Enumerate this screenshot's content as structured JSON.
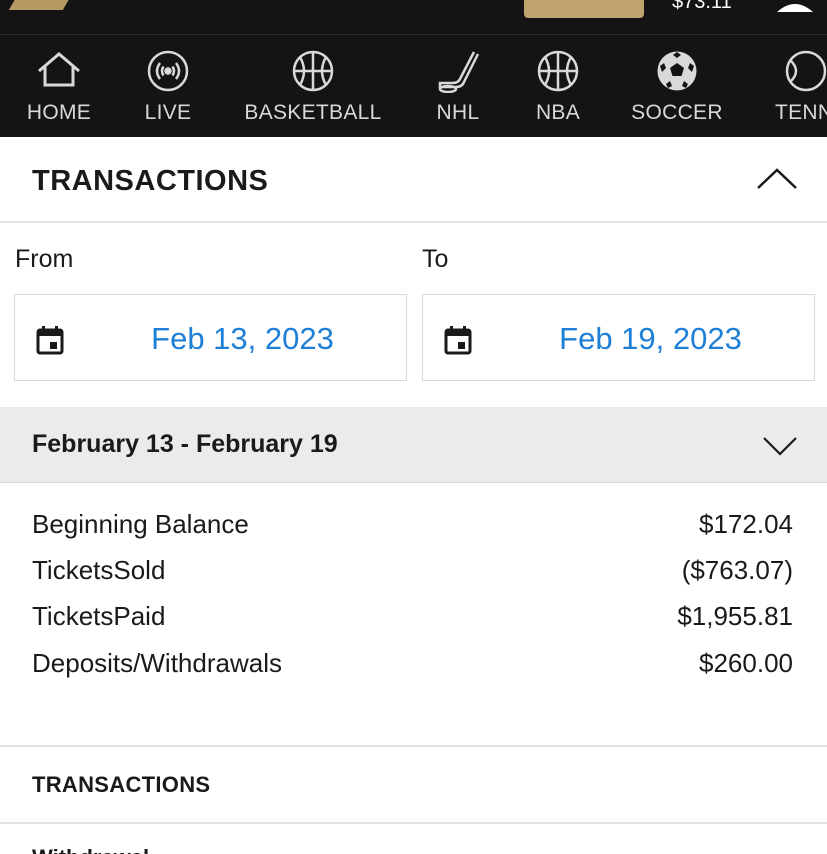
{
  "header": {
    "balance_label": "$73.11 ",
    "logo_icon": "brand-logo",
    "user_icon": "user-icon"
  },
  "sport_nav": {
    "items": [
      {
        "label": "HOME",
        "icon": "home-icon"
      },
      {
        "label": "LIVE",
        "icon": "live-broadcast-icon"
      },
      {
        "label": "BASKETBALL",
        "icon": "basketball-icon"
      },
      {
        "label": "NHL",
        "icon": "hockey-stick-icon"
      },
      {
        "label": "NBA",
        "icon": "basketball-icon"
      },
      {
        "label": "SOCCER",
        "icon": "soccer-ball-icon"
      },
      {
        "label": "TENN",
        "icon": "tennis-ball-icon"
      }
    ]
  },
  "transactions": {
    "title": "TRANSACTIONS",
    "from_label": "From",
    "to_label": "To",
    "from_date": "Feb 13, 2023",
    "to_date": "Feb 19, 2023",
    "period_title": "February 13 - February 19",
    "summary": [
      {
        "label": "Beginning Balance",
        "value": "$172.04"
      },
      {
        "label": "TicketsSold",
        "value": "($763.07)"
      },
      {
        "label": "TicketsPaid",
        "value": "$1,955.81"
      },
      {
        "label": "Deposits/Withdrawals",
        "value": "$260.00"
      }
    ],
    "list_title": "TRANSACTIONS",
    "first_item_partial": "Withdrawal"
  },
  "colors": {
    "nav_bg": "#141414",
    "gold": "#bfa46f",
    "link_blue": "#1e7fd6",
    "band_gray": "#ebebeb"
  }
}
